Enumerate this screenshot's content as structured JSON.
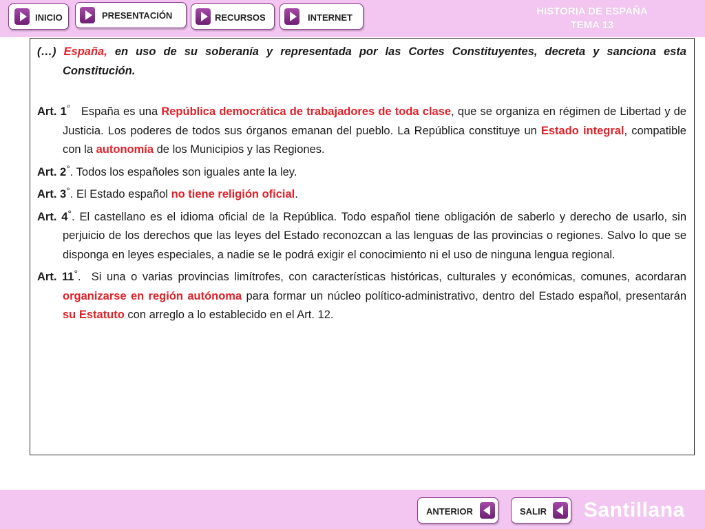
{
  "nav": {
    "inicio": "INICIO",
    "presentacion": "PRESENTACIÓN",
    "recursos": "RECURSOS",
    "internet": "INTERNET"
  },
  "course": {
    "line1": "HISTORIA DE ESPAÑA",
    "line2": "TEMA 13"
  },
  "content": {
    "intro": {
      "lead": "(…) ",
      "spain": "España,",
      "rest": " en uso de su soberanía y representada por las Cortes Constituyentes, decreta y sanciona esta Constitución."
    },
    "art1": {
      "label": "Art. 1",
      "deg": "°",
      "t1": "   España es una ",
      "h1": "República democrática de trabajadores de toda clase",
      "t2": ", que se organiza en régimen de Libertad y de Justicia. Los poderes de todos sus órganos emanan del pueblo. La República constituye un ",
      "h2": "Estado integral",
      "t3": ", compatible con la ",
      "h3": "autonomía",
      "t4": " de los Municipios y las Regiones."
    },
    "art2": {
      "label": "Art. 2",
      "deg": "°",
      "text": ". Todos los españoles son iguales ante la ley."
    },
    "art3": {
      "label": "Art. 3",
      "deg": "°",
      "t1": ". El Estado español ",
      "h1": "no tiene religión oficial",
      "t2": "."
    },
    "art4": {
      "label": "Art. 4",
      "deg": "°",
      "text": ". El castellano es el idioma oficial de la República. Todo español tiene obligación de saberlo y derecho de usarlo, sin perjuicio de los derechos que las leyes del Estado reconozcan a las lenguas de las provincias o regiones. Salvo lo que se disponga en leyes especiales, a nadie se le podrá exigir el conocimiento ni el uso de ninguna lengua regional."
    },
    "art11": {
      "label": "Art. 11",
      "deg": "°",
      "t1": ".  Si una o varias provincias limítrofes, con características históricas, culturales y económicas, comunes, acordaran ",
      "h1": "organizarse en región autónoma",
      "t2": " para formar un núcleo político-administrativo, dentro del Estado español, presentarán ",
      "h2": "su Estatuto",
      "t3": " con arreglo a lo establecido en el Art. 12."
    }
  },
  "footer": {
    "anterior": "ANTERIOR",
    "salir": "SALIR",
    "brand": "Santillana"
  },
  "colors": {
    "bar": "#f2c6f0",
    "button_border": "#8b3b8e",
    "arrow": "#8a3490",
    "highlight": "#e11f27"
  }
}
